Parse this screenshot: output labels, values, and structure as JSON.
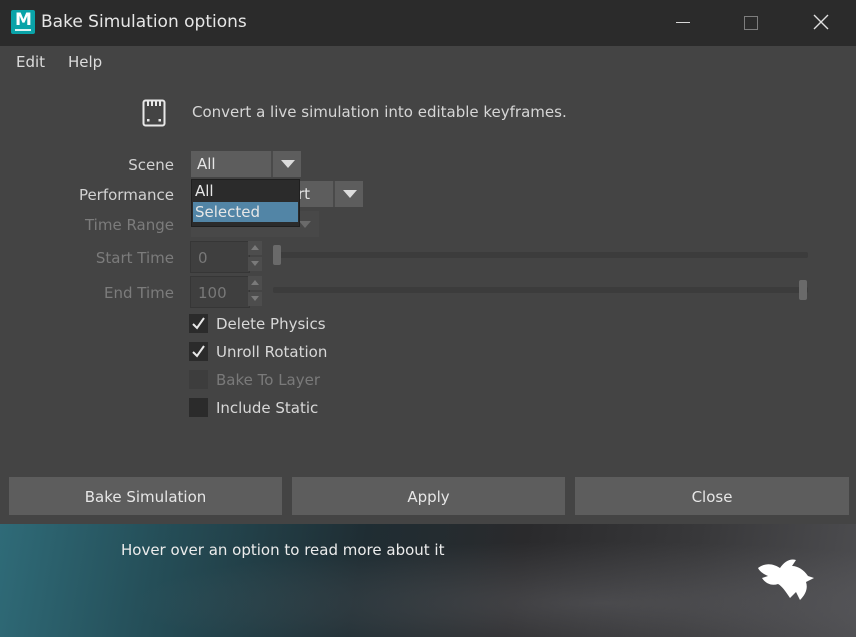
{
  "window": {
    "title": "Bake Simulation options",
    "app_icon": "maya-app-icon",
    "controls": [
      "minimize-icon",
      "maximize-icon",
      "close-icon"
    ]
  },
  "menu": [
    "Edit",
    "Help"
  ],
  "description": {
    "icon": "bake-clip-icon",
    "text": "Convert a live simulation into editable keyframes."
  },
  "form": {
    "scene": {
      "label": "Scene",
      "value": "All",
      "options": [
        {
          "label": "All",
          "highlighted": false
        },
        {
          "label": "Selected",
          "highlighted": true
        }
      ]
    },
    "performance": {
      "label": "Performance",
      "visible_value_fragment": "rt"
    },
    "time_range": {
      "label": "Time Range",
      "enabled": false
    },
    "start_time": {
      "label": "Start Time",
      "value": "0",
      "enabled": false,
      "slider_fraction": 0.0
    },
    "end_time": {
      "label": "End Time",
      "value": "100",
      "enabled": false,
      "slider_fraction": 1.0
    },
    "checkboxes": [
      {
        "label": "Delete Physics",
        "checked": true,
        "enabled": true
      },
      {
        "label": "Unroll Rotation",
        "checked": true,
        "enabled": true
      },
      {
        "label": "Bake To Layer",
        "checked": false,
        "enabled": false
      },
      {
        "label": "Include Static",
        "checked": false,
        "enabled": true
      }
    ]
  },
  "buttons": {
    "bake": "Bake Simulation",
    "apply": "Apply",
    "close": "Close"
  },
  "help": {
    "text": "Hover over an option to read more about it",
    "logo": "fox-logo-icon"
  },
  "colors": {
    "window_bg": "#444444",
    "titlebar_bg": "#2b2b2b",
    "selection": "#5285a6",
    "app_icon": "#0aa3a8"
  }
}
